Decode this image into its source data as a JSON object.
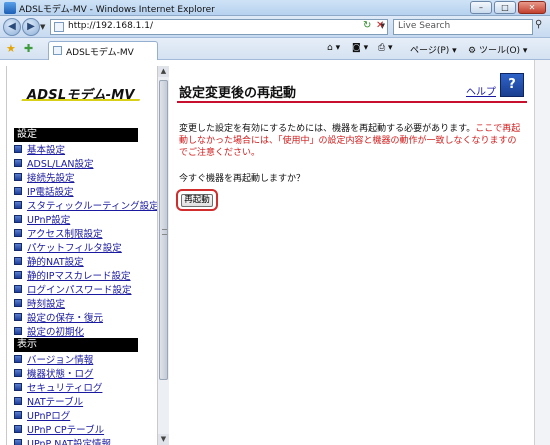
{
  "window": {
    "title": "ADSLモデム-MV - Windows Internet Explorer",
    "buttons": {
      "minimize": "–",
      "maximize": "□",
      "close": "✕"
    }
  },
  "address_bar": {
    "url": "http://192.168.1.1/",
    "search_placeholder": "Live Search"
  },
  "tab": {
    "label": "ADSLモデム-MV"
  },
  "command_bar": {
    "page_label": "ページ(P)",
    "tools_label": "ツール(O)"
  },
  "sidebar": {
    "logo": "ADSLモデム-MV",
    "settings_header": "設定",
    "settings_items": [
      "基本設定",
      "ADSL/LAN設定",
      "接続先設定",
      "IP電話設定",
      "スタティックルーティング設定",
      "UPnP設定",
      "アクセス制限設定",
      "パケットフィルタ設定",
      "静的NAT設定",
      "静的IPマスカレード設定",
      "ログインパスワード設定",
      "時刻設定",
      "設定の保存・復元",
      "設定の初期化"
    ],
    "display_header": "表示",
    "display_items": [
      "バージョン情報",
      "機器状態・ログ",
      "セキュリティログ",
      "NATテーブル",
      "UPnPログ",
      "UPnP CPテーブル",
      "UPnP NAT設定情報"
    ]
  },
  "main": {
    "title": "設定変更後の再起動",
    "help_label": "ヘルプ",
    "message_black": "変更した設定を有効にするためには、機器を再起動する必要があります。",
    "message_red": "ここで再起動しなかった場合には、「使用中」の設定内容と機器の動作が一致しなくなりますのでご注意ください。",
    "question": "今すぐ機器を再起動しますか？",
    "restart_button": "再起動"
  }
}
